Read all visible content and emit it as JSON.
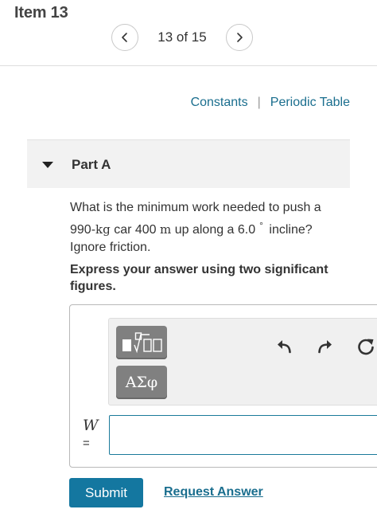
{
  "header": {
    "title": "Item 13",
    "pager": {
      "text": "13 of 15",
      "prev_icon": "chevron-left-icon",
      "next_icon": "chevron-right-icon"
    }
  },
  "links": {
    "constants": "Constants",
    "separator": "|",
    "periodic_table": "Periodic Table"
  },
  "part": {
    "label": "Part A",
    "caret_icon": "caret-down-icon"
  },
  "question": {
    "text_1": "What is the minimum work needed to push a",
    "mass_value": "990",
    "mass_unit": "kg",
    "text_2": "car",
    "distance_value": "400",
    "distance_unit": "m",
    "text_3": "up along a",
    "angle_value": "6.0",
    "angle_unit": "°",
    "text_4": "incline?",
    "text_5": "Ignore friction."
  },
  "instruction": "Express your answer using two significant figures.",
  "answer": {
    "variable": "W",
    "equals": "=",
    "value": "",
    "toolbar": {
      "templates_icon": "templates-icon",
      "symbols_label": "ΑΣφ",
      "undo_icon": "undo-icon",
      "redo_icon": "redo-icon",
      "reset_icon": "reset-icon"
    }
  },
  "actions": {
    "submit": "Submit",
    "request_answer": "Request Answer"
  },
  "colors": {
    "accent": "#1477a0",
    "link": "#1a6e8e",
    "toolbar_button": "#808080"
  }
}
